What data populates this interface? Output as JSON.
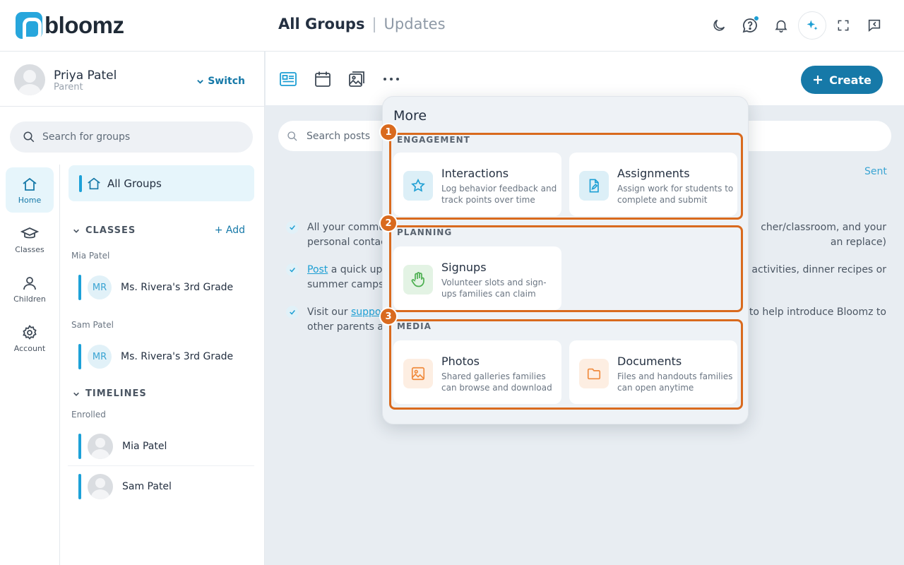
{
  "header": {
    "logo_text": "bloomz",
    "title": "All Groups",
    "separator": "|",
    "subtitle": "Updates",
    "icons": [
      "moon-icon",
      "help-chat-icon",
      "bell-icon",
      "sparkle-icon",
      "fullscreen-icon",
      "collapse-panel-icon"
    ]
  },
  "user": {
    "name": "Priya Patel",
    "role": "Parent",
    "switch_label": "Switch"
  },
  "sidebar": {
    "search_placeholder": "Search for groups",
    "rail": [
      {
        "label": "Home",
        "icon": "home-icon"
      },
      {
        "label": "Classes",
        "icon": "graduation-cap-icon"
      },
      {
        "label": "Children",
        "icon": "person-icon"
      },
      {
        "label": "Account",
        "icon": "gear-icon"
      }
    ],
    "all_groups": "All Groups",
    "classes_header": "CLASSES",
    "add_label": "Add",
    "classes": [
      {
        "child": "Mia Patel",
        "initials": "MR",
        "name": "Ms. Rivera's 3rd Grade"
      },
      {
        "child": "Sam Patel",
        "initials": "MR",
        "name": "Ms. Rivera's 3rd Grade"
      }
    ],
    "timelines_header": "TIMELINES",
    "enrolled_label": "Enrolled",
    "timelines": [
      {
        "name": "Mia Patel"
      },
      {
        "name": "Sam Patel"
      }
    ]
  },
  "toolbar": {
    "create_label": "Create",
    "tools": [
      "news-icon",
      "calendar-icon",
      "gallery-icon",
      "more-icon"
    ]
  },
  "main": {
    "search_placeholder": "Search posts",
    "sent_label": "Sent",
    "tips": [
      {
        "before": "All your commu",
        "after": "cher/classroom, and your",
        "line2_before": "personal contac",
        "line2_after": "an replace)"
      },
      {
        "link": "Post",
        "before": " a quick upd",
        "after": " activities, dinner recipes or",
        "line2_before": "summer camps.",
        "line2_after": ""
      },
      {
        "before": "Visit our ",
        "link": "support",
        "after": "s to help introduce Bloomz to",
        "line2_before": "other parents ar",
        "line2_after": ""
      }
    ]
  },
  "more_menu": {
    "title": "More",
    "groups": [
      {
        "badge": "1",
        "label": "ENGAGEMENT",
        "items": [
          {
            "title": "Interactions",
            "desc": "Log behavior feedback and track points over time",
            "icon": "star-icon",
            "color": "#1d9fd4"
          },
          {
            "title": "Assignments",
            "desc": "Assign work for students to complete and submit",
            "icon": "assignment-icon",
            "color": "#1d9fd4"
          }
        ]
      },
      {
        "badge": "2",
        "label": "PLANNING",
        "items": [
          {
            "title": "Signups",
            "desc": "Volunteer slots and sign-ups families can claim",
            "icon": "hand-icon",
            "color": "#4caf50"
          }
        ]
      },
      {
        "badge": "3",
        "label": "MEDIA",
        "items": [
          {
            "title": "Photos",
            "desc": "Shared galleries families can browse and download",
            "icon": "photo-icon",
            "color": "#f08a3c"
          },
          {
            "title": "Documents",
            "desc": "Files and handouts families can open anytime",
            "icon": "folder-icon",
            "color": "#f08a3c"
          }
        ]
      }
    ]
  },
  "colors": {
    "brand": "#1679a8",
    "accent": "#1d9fd4",
    "highlight": "#d96a1e"
  }
}
